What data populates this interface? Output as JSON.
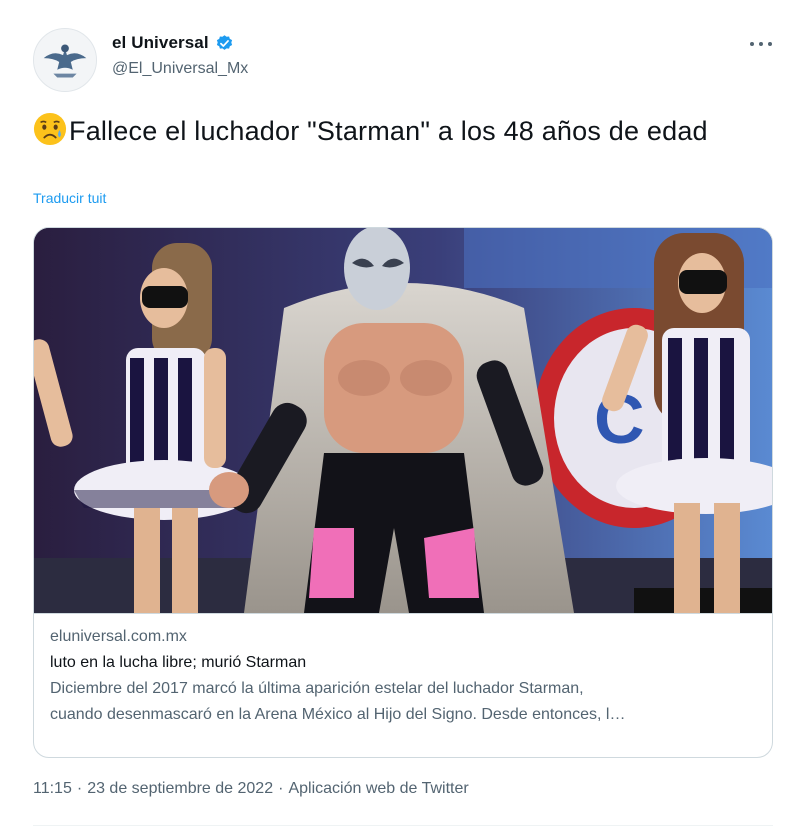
{
  "author": {
    "display_name": "el Universal",
    "handle": "@El_Universal_Mx",
    "verified": true,
    "avatar_icon": "eagle-logo-icon"
  },
  "tweet": {
    "emoji_icon": "sad-but-relieved-face-icon",
    "text": "Fallece el luchador \"Starman\" a los 48 años de edad",
    "translate_label": "Traducir tuit"
  },
  "card": {
    "image_icon": "wrestler-photo",
    "domain": "eluniversal.com.mx",
    "title": "luto en la lucha libre; murió Starman",
    "description_line1": "Diciembre del 2017 marcó la última aparición estelar del luchador Starman,",
    "description_line2": "cuando desenmascaró en la Arena México al Hijo del Signo. Desde entonces, l…"
  },
  "footer": {
    "time": "11:15",
    "separator": "·",
    "date": "23 de septiembre de 2022",
    "separator2": "·",
    "source": "Aplicación web de Twitter"
  },
  "colors": {
    "link": "#1d9bf0",
    "secondary_text": "#536471",
    "border": "#cfd9de"
  }
}
